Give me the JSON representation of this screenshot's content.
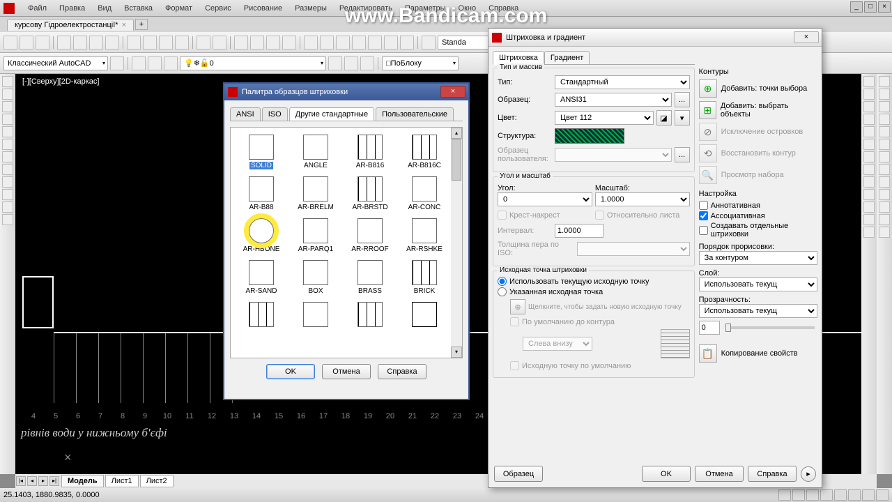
{
  "watermark": "www.Bandicam.com",
  "menu": [
    "Файл",
    "Правка",
    "Вид",
    "Вставка",
    "Формат",
    "Сервис",
    "Рисование",
    "Размеры",
    "Редактировать",
    "Параметры",
    "Окно",
    "Справка"
  ],
  "doctab": {
    "name": "курсову Гідроелектростанції*",
    "mod": "×"
  },
  "workspace": "Классический AutoCAD",
  "style_dd": "Standa",
  "layer": "0",
  "bylayer": "ПоБлоку",
  "view_label": "[-][Сверху][2D-каркас]",
  "ruler": [
    "4",
    "5",
    "6",
    "7",
    "8",
    "9",
    "10",
    "11",
    "12",
    "13",
    "14",
    "15",
    "16",
    "17",
    "18",
    "19",
    "20",
    "21",
    "22",
    "23",
    "24"
  ],
  "ru_text": "рівнів води у нижньому б'єфі",
  "bottom_tabs": {
    "model": "Модель",
    "l1": "Лист1",
    "l2": "Лист2"
  },
  "status_coords": "25.1403, 1880.9835, 0.0000",
  "palette": {
    "title": "Палитра образцов штриховки",
    "tabs": [
      "ANSI",
      "ISO",
      "Другие стандартные",
      "Пользовательские"
    ],
    "items": [
      [
        "SOLID",
        "pat-solid",
        "sel"
      ],
      [
        "ANGLE",
        "pat-angle",
        ""
      ],
      [
        "AR-B816",
        "pat-brick",
        ""
      ],
      [
        "AR-B816C",
        "pat-brick",
        ""
      ],
      [
        "AR-B88",
        "pat-angle",
        ""
      ],
      [
        "AR-BRELM",
        "pat-dark",
        ""
      ],
      [
        "AR-BRSTD",
        "pat-brick",
        ""
      ],
      [
        "AR-CONC",
        "pat-conc",
        ""
      ],
      [
        "AR-HBONE",
        "pat-hbone",
        "hl"
      ],
      [
        "AR-PARQ1",
        "pat-dark",
        ""
      ],
      [
        "AR-RROOF",
        "pat-black",
        ""
      ],
      [
        "AR-RSHKE",
        "pat-conc",
        ""
      ],
      [
        "AR-SAND",
        "pat-conc",
        ""
      ],
      [
        "BOX",
        "pat-angle",
        ""
      ],
      [
        "BRASS",
        "pat-vert",
        ""
      ],
      [
        "BRICK",
        "pat-brick",
        ""
      ],
      [
        "",
        "pat-brick",
        ""
      ],
      [
        "",
        "pat-black",
        ""
      ],
      [
        "",
        "pat-brick",
        ""
      ],
      [
        "",
        "pat-outline",
        ""
      ]
    ],
    "btn_ok": "OK",
    "btn_cancel": "Отмена",
    "btn_help": "Справка"
  },
  "hatch": {
    "title": "Штриховка и градиент",
    "tab_hatch": "Штриховка",
    "tab_grad": "Градиент",
    "g_type": "Тип и массив",
    "l_type": "Тип:",
    "v_type": "Стандартный",
    "l_pattern": "Образец:",
    "v_pattern": "ANSI31",
    "l_color": "Цвет:",
    "v_color": "Цвет 112",
    "l_struct": "Структура:",
    "l_userpat": "Образец пользователя:",
    "g_angle": "Угол и масштаб",
    "l_angle": "Угол:",
    "v_angle": "0",
    "l_scale": "Масштаб:",
    "v_scale": "1.0000",
    "chk_cross": "Крест-накрест",
    "chk_rel": "Относительно листа",
    "l_interval": "Интервал:",
    "v_interval": "1.0000",
    "l_penw": "Толщина пера по ISO:",
    "g_origin": "Исходная точка штриховки",
    "r_cur": "Использовать текущую исходную точку",
    "r_spec": "Указанная исходная точка",
    "origin_hint": "Щелкните, чтобы задать новую исходную точку",
    "chk_bydef": "По умолчанию до контура",
    "dd_pos": "Слева внизу",
    "chk_asdef": "Исходную точку по умолчанию",
    "g_contours": "Контуры",
    "btn_addpt": "Добавить: точки выбора",
    "btn_addobj": "Добавить: выбрать объекты",
    "btn_excl": "Исключение островков",
    "btn_restore": "Восстановить контур",
    "btn_view": "Просмотр набора",
    "g_settings": "Настройка",
    "chk_annot": "Аннотативная",
    "chk_assoc": "Ассоциативная",
    "chk_sep": "Создавать отдельные штриховки",
    "l_draworder": "Порядок прорисовки:",
    "v_draworder": "За контуром",
    "l_layer": "Слой:",
    "v_layer": "Использовать текущ",
    "l_trans": "Прозрачность:",
    "v_trans": "Использовать текущ",
    "v_trans_n": "0",
    "btn_copy": "Копирование свойств",
    "btn_preview": "Образец",
    "btn_ok": "OK",
    "btn_cancel": "Отмена",
    "btn_help": "Справка"
  }
}
